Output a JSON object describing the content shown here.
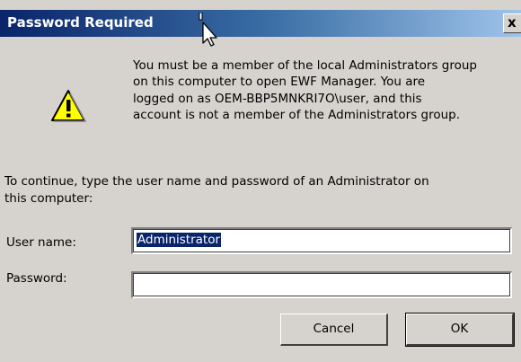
{
  "window": {
    "title": "Password Required",
    "close_label": "x"
  },
  "message": "You must be a member of the local Administrators group\non this computer to open EWF Manager.  You are\nlogged on as OEM-BBP5MNKRI7O\\user, and this\naccount is not a member of the Administrators group.",
  "instruction": "To continue, type the user name and password of an Administrator on\nthis computer:",
  "form": {
    "username_label": "User name:",
    "username_value": "Administrator",
    "password_label": "Password:",
    "password_value": ""
  },
  "buttons": {
    "cancel": "Cancel",
    "ok": "OK"
  },
  "icons": {
    "warning": "warning-icon",
    "cursor": "mouse-cursor-icon"
  },
  "colors": {
    "title_bar_start": "#0a246a",
    "title_bar_end": "#a6caf0",
    "dialog_background": "#d6d3ce",
    "selection": "#0a246a"
  }
}
